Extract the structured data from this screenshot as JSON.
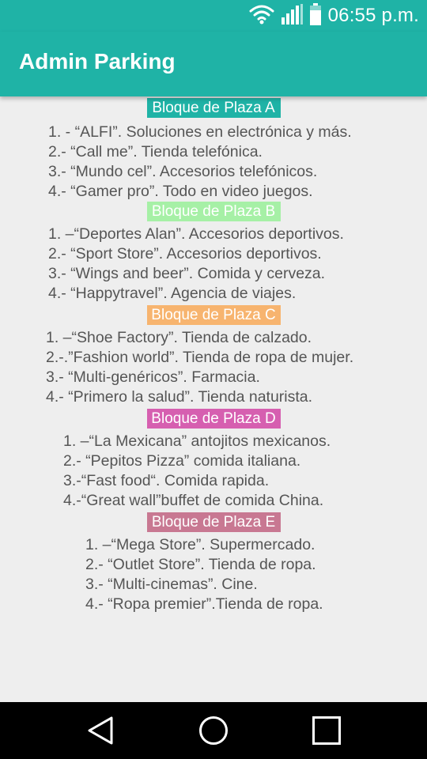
{
  "status": {
    "time": "06:55 p.m."
  },
  "app": {
    "title": "Admin Parking"
  },
  "colors": {
    "primary": "#1fb3a6",
    "block_a": "#1fb3a6",
    "block_b": "#a6f0a6",
    "block_c": "#f7b46f",
    "block_d": "#d65fb0",
    "block_e": "#c87892"
  },
  "blocks": [
    {
      "header": "Bloque de Plaza A",
      "items": [
        "1. - “ALFI”. Soluciones en electrónica y más.",
        "2.- “Call me”. Tienda  telefónica.",
        "3.- “Mundo cel”. Accesorios telefónicos.",
        "4.- “Gamer pro”. Todo en video juegos."
      ]
    },
    {
      "header": "Bloque de Plaza B",
      "items": [
        "1. –“Deportes Alan”. Accesorios deportivos.",
        "2.- “Sport Store”. Accesorios deportivos.",
        "3.- “Wings and beer”. Comida y cerveza.",
        "4.- “Happytravel”. Agencia de viajes."
      ]
    },
    {
      "header": "Bloque de Plaza C",
      "items": [
        "1. –“Shoe Factory”. Tienda de calzado.",
        "2.-.”Fashion world”. Tienda de ropa de mujer.",
        "3.- “Multi-genéricos”. Farmacia.",
        "4.- “Primero la salud”. Tienda naturista."
      ]
    },
    {
      "header": "Bloque de Plaza D",
      "items": [
        "1. –“La Mexicana” antojitos mexicanos.",
        "2.- “Pepitos Pizza” comida italiana.",
        "3.-“Fast food“. Comida rapida.",
        "4.-“Great wall”buffet de comida China."
      ]
    },
    {
      "header": "Bloque de Plaza E",
      "items": [
        "1. –“Mega Store”. Supermercado.",
        "2.- “Outlet Store”. Tienda de ropa.",
        "3.- “Multi-cinemas”. Cine.",
        "4.- “Ropa premier”.Tienda de ropa."
      ]
    }
  ],
  "nav": {
    "back": "back-icon",
    "home": "home-icon",
    "recents": "recents-icon"
  }
}
